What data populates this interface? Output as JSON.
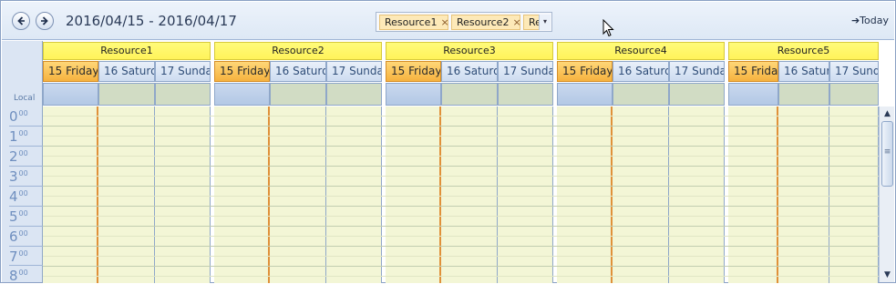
{
  "toolbar": {
    "prev_icon": "arrow-left-icon",
    "next_icon": "arrow-right-icon",
    "date_range": "2016/04/15 - 2016/04/17",
    "filter_chips": [
      "Resource1",
      "Resource2",
      "Re"
    ],
    "chip_remove_glyph": "×",
    "dropdown_glyph": "▾",
    "today_label": "Today",
    "today_glyph": "➔"
  },
  "resources": [
    {
      "name": "Resource1",
      "days": [
        "15 Friday",
        "16 Saturd",
        "17 Sunda"
      ]
    },
    {
      "name": "Resource2",
      "days": [
        "15 Friday",
        "16 Saturd",
        "17 Sunda"
      ]
    },
    {
      "name": "Resource3",
      "days": [
        "15 Friday",
        "16 Saturd",
        "17 Sunda"
      ]
    },
    {
      "name": "Resource4",
      "days": [
        "15 Friday",
        "16 Saturd",
        "17 Sunda"
      ]
    },
    {
      "name": "Resource5",
      "days": [
        "15 Frida",
        "16 Satur",
        "17 Sund"
      ]
    }
  ],
  "time_ruler": {
    "timezone_label": "Local",
    "hours": [
      {
        "h": "0",
        "m": "00"
      },
      {
        "h": "1",
        "m": "00"
      },
      {
        "h": "2",
        "m": "00"
      },
      {
        "h": "3",
        "m": "00"
      },
      {
        "h": "4",
        "m": "00"
      },
      {
        "h": "5",
        "m": "00"
      },
      {
        "h": "6",
        "m": "00"
      },
      {
        "h": "7",
        "m": "00"
      },
      {
        "h": "8",
        "m": "00"
      }
    ]
  },
  "scrollbar": {
    "up_glyph": "▲",
    "down_glyph": "▼",
    "grip_glyph": "≡"
  },
  "colors": {
    "today_header": "#f6b23f",
    "resource_header": "#fff35a",
    "work_cell": "#f3f6d6",
    "accent_border": "#e0913a"
  }
}
